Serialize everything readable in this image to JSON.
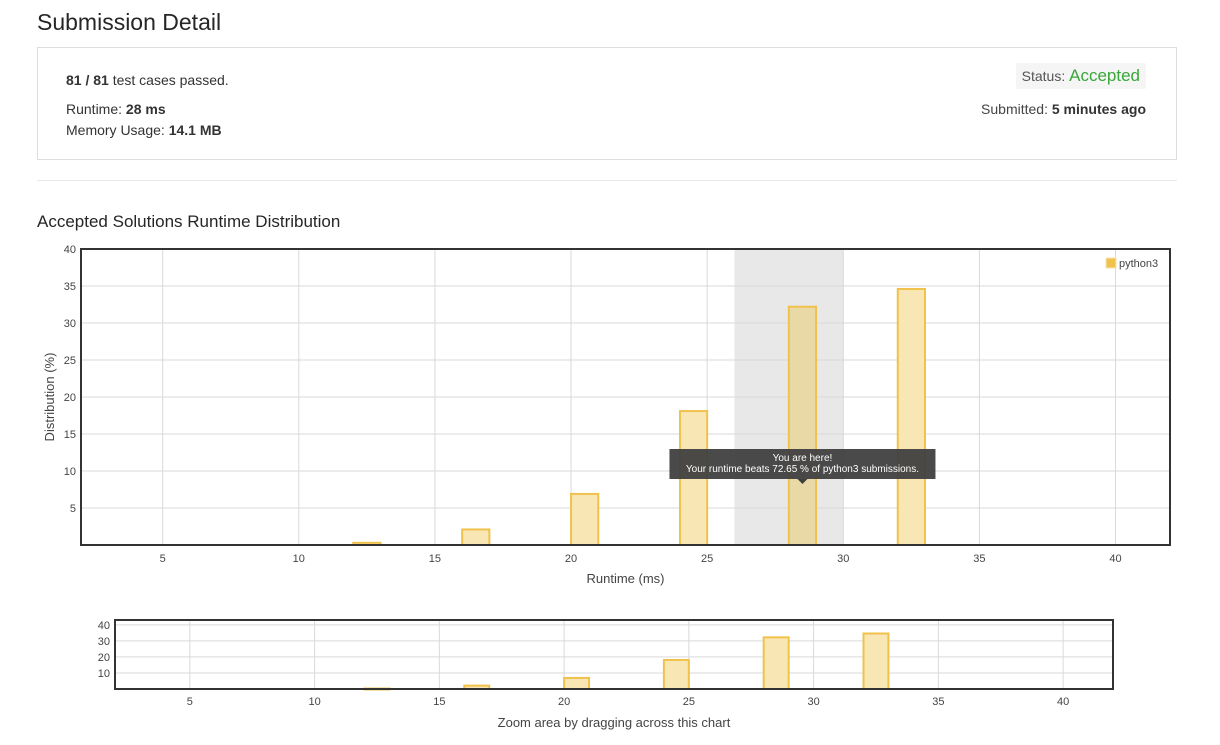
{
  "page": {
    "title": "Submission Detail"
  },
  "summary": {
    "tests_passed": "81 / 81",
    "tests_text": " test cases passed.",
    "runtime_label": "Runtime: ",
    "runtime_value": "28 ms",
    "memory_label": "Memory Usage: ",
    "memory_value": "14.1 MB",
    "status_label": "Status: ",
    "status_value": "Accepted",
    "submitted_label": "Submitted: ",
    "submitted_value": "5 minutes ago"
  },
  "distribution": {
    "title": "Accepted Solutions Runtime Distribution"
  },
  "colors": {
    "bar_fill": "#f8e6b4",
    "bar_stroke": "#f0c24b",
    "selected_fill": "#e9d9a6",
    "highlight_band": "#e8e8e8",
    "grid": "#d9d9d9",
    "axis": "#333333",
    "tooltip_bg": "#404040",
    "accepted": "#3aa63a"
  },
  "chart_data": [
    {
      "type": "bar",
      "xlabel": "Runtime (ms)",
      "ylabel": "Distribution (%)",
      "xlim": [
        2,
        42
      ],
      "ylim": [
        0,
        40
      ],
      "xticks": [
        5,
        10,
        15,
        20,
        25,
        30,
        35,
        40
      ],
      "yticks": [
        5,
        10,
        15,
        20,
        25,
        30,
        35,
        40
      ],
      "grid": true,
      "legend": {
        "position": "top-right",
        "entries": [
          "python3"
        ]
      },
      "highlight_range": [
        26,
        30
      ],
      "series": [
        {
          "name": "python3",
          "bars": [
            {
              "x": 12.5,
              "value": 0.3
            },
            {
              "x": 16.5,
              "value": 2.1
            },
            {
              "x": 20.5,
              "value": 6.9
            },
            {
              "x": 24.5,
              "value": 18.1
            },
            {
              "x": 28.5,
              "value": 32.2,
              "selected": true
            },
            {
              "x": 32.5,
              "value": 34.6
            }
          ]
        }
      ],
      "annotation": {
        "title": "You are here!",
        "text": "Your runtime beats 72.65 % of python3 submissions."
      }
    },
    {
      "type": "bar",
      "xlabel": "Zoom area by dragging across this chart",
      "xlim": [
        2,
        42
      ],
      "ylim": [
        0,
        43
      ],
      "xticks": [
        5,
        10,
        15,
        20,
        25,
        30,
        35,
        40
      ],
      "yticks": [
        10,
        20,
        30,
        40
      ],
      "grid": true,
      "series": [
        {
          "bars": [
            {
              "x": 12.5,
              "value": 0.3
            },
            {
              "x": 16.5,
              "value": 2.1
            },
            {
              "x": 20.5,
              "value": 6.9
            },
            {
              "x": 24.5,
              "value": 18.1
            },
            {
              "x": 28.5,
              "value": 32.2
            },
            {
              "x": 32.5,
              "value": 34.6
            }
          ]
        }
      ]
    }
  ]
}
